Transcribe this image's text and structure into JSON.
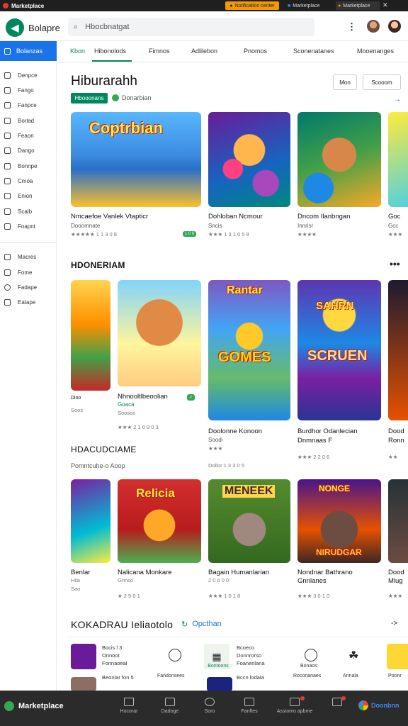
{
  "os_bar": {
    "app_name": "Marketplace",
    "notification": "Notification center",
    "tab1": "Marketplace",
    "tab2": "Marketplace",
    "close": "✕"
  },
  "header": {
    "brand": "Bolapre",
    "search_placeholder": "Hbocbnatgat",
    "menu_icon": "⋮"
  },
  "sidebar": {
    "active": "Bolanzas",
    "items": [
      "Denpce",
      "Fango",
      "Fanpce",
      "Borlad",
      "Feaon",
      "Dango",
      "Bonnpe",
      "Cmoa",
      "Enion",
      "Scaib",
      "Foapnt"
    ],
    "items2": [
      "Macres",
      "Fome",
      "Fadape",
      "Eatape"
    ]
  },
  "nav": {
    "tabs": [
      "Kbon",
      "Hibonolods",
      "Fimnos",
      "Adlilebon",
      "Pnomos",
      "Sconenatanes",
      "Mooenanges"
    ]
  },
  "section1": {
    "title": "Hiburarahh",
    "badge": "Hbooonans",
    "subtitle": "Donarbian",
    "btn1": "Mon",
    "btn2": "Scooom",
    "arrow": "→",
    "cards": [
      {
        "art": "Coptrbian",
        "t1": "Nmcaefoe Vanlek Vtapticr",
        "t2": "Dooomnate",
        "t3": "★★★★★ 1 1 3 0 8",
        "badge": "1 0 0"
      },
      {
        "t1": "Dohloban Ncmour",
        "t2": "Sncis",
        "t3": "★★★ 1 3 1 0 5 8"
      },
      {
        "t1": "Dncom Ilanbngan",
        "t2": "Innrisr",
        "t3": "★★★★"
      },
      {
        "t1": "Goc",
        "t2": "Gcc",
        "t3": "★★★"
      }
    ]
  },
  "section2": {
    "title": "HDONERIAM",
    "more": "•••",
    "cards": [
      {
        "t1": "Dino",
        "t2": "Soos",
        "t3": "Soos"
      },
      {
        "t1": "Nhnooltlbeoolian",
        "t2": "Goaca",
        "t3": "Soosos",
        "t4": "★★★ 2 1 0 9 0 3"
      },
      {
        "art": "Rantar",
        "art2": "GOMES",
        "t1": "Doolonne Konoon",
        "t2": "Soodi",
        "t3": "★★★",
        "t4": "Dollor 1 3 3 0 5"
      },
      {
        "art": "SAHRN",
        "art2": "SCRUEN",
        "t1": "Burdhor Odanlecian",
        "t2": "Dnmnaas F",
        "t3": "★★★ 2 2 0 6"
      },
      {
        "t1": "Dood",
        "t2": "Ronn",
        "t3": "★★"
      }
    ]
  },
  "section3": {
    "title": "HDACUDCIAME",
    "subtitle": "Pomntcuhe-o Aoop",
    "cards": [
      {
        "t1": "Benlar",
        "t2": "Hila",
        "t3": "Sao"
      },
      {
        "art": "Relicia",
        "t1": "Nalicana Monkare",
        "t2": "Gnnso",
        "t3": "★ 2 5 0 1"
      },
      {
        "art": "MENEEK",
        "t1": "Bagain Humanlarian",
        "t2": "2 0 6 0 0",
        "t3": "★★★ 1 0 1 8"
      },
      {
        "art": "NONGE",
        "art2": "NIRUDGAR",
        "t1": "Nondnar Bathrano",
        "t2": "Gnnlanes",
        "t3": "★★★ 3 0 1 0"
      },
      {
        "t1": "Dood",
        "t2": "Mlug",
        "t3": "★★★"
      }
    ]
  },
  "section4": {
    "title": "KOKADRAU Ieliaotolo",
    "link": "Opcthan",
    "arrow": "->",
    "items": [
      {
        "lines": [
          "Bocis l 3",
          "Onnoot",
          "Fonnaoeal"
        ]
      },
      {
        "label": "Fandonsees"
      },
      {
        "label": "Bontoons",
        "active": true
      },
      {
        "lines": [
          "Bcoeco",
          "Donnrorso",
          "Foanenlana"
        ]
      },
      {
        "label": "Bonaos"
      },
      {
        "label": "Roconanaes"
      },
      {
        "label": "Annala"
      },
      {
        "label": "Poonr"
      }
    ],
    "row2": [
      {
        "lines": [
          "Beonlar fon 5"
        ]
      },
      {
        "lines": [
          "Bccn lodaia"
        ]
      }
    ]
  },
  "dock": {
    "brand": "Marketplace",
    "items": [
      "Hocorar",
      "Dadoge",
      "Soro",
      "Fanftes",
      "Asstomo apbme",
      ""
    ],
    "right": "Doonbnn"
  },
  "colors": {
    "accent": "#01875f",
    "blue": "#1a73e8",
    "star": "#f4b400"
  }
}
